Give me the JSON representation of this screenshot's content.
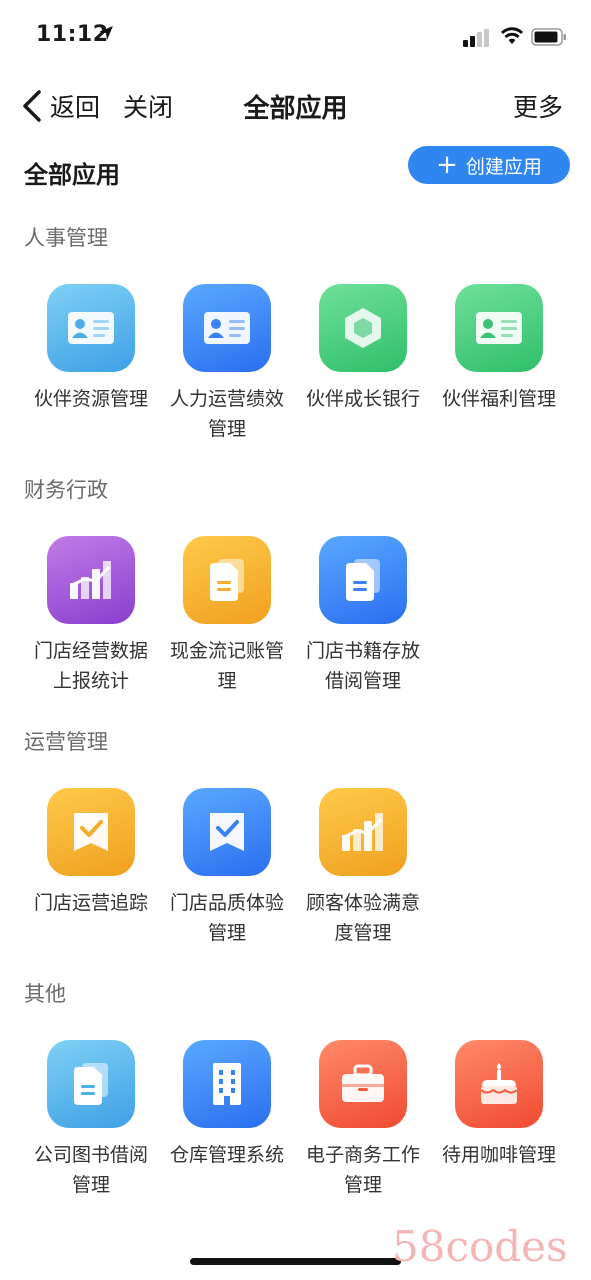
{
  "status_bar": {
    "time": "11:12"
  },
  "nav": {
    "back_label": "返回",
    "close_label": "关闭",
    "title": "全部应用",
    "more_label": "更多"
  },
  "header": {
    "section_title": "全部应用",
    "create_label": "创建应用"
  },
  "categories": [
    {
      "label": "人事管理",
      "apps": [
        {
          "name": "伙伴资源管理",
          "icon": "id-card-icon",
          "color": "lightblue"
        },
        {
          "name": "人力运营绩效管理",
          "icon": "id-card-icon",
          "color": "blue"
        },
        {
          "name": "伙伴成长银行",
          "icon": "cube-icon",
          "color": "green"
        },
        {
          "name": "伙伴福利管理",
          "icon": "id-card-icon",
          "color": "green"
        }
      ]
    },
    {
      "label": "财务行政",
      "apps": [
        {
          "name": "门店经营数据上报统计",
          "icon": "bar-chart-icon",
          "color": "purple"
        },
        {
          "name": "现金流记账管理",
          "icon": "document-icon",
          "color": "yellow"
        },
        {
          "name": "门店书籍存放借阅管理",
          "icon": "document-icon",
          "color": "blue"
        }
      ]
    },
    {
      "label": "运营管理",
      "apps": [
        {
          "name": "门店运营追踪",
          "icon": "checked-flag-icon",
          "color": "yellow"
        },
        {
          "name": "门店品质体验管理",
          "icon": "checked-flag-icon",
          "color": "blue"
        },
        {
          "name": "顾客体验满意度管理",
          "icon": "bar-chart-icon",
          "color": "yellow"
        }
      ]
    },
    {
      "label": "其他",
      "apps": [
        {
          "name": "公司图书借阅管理",
          "icon": "document-icon",
          "color": "lightblue"
        },
        {
          "name": "仓库管理系统",
          "icon": "building-icon",
          "color": "blue"
        },
        {
          "name": "电子商务工作管理",
          "icon": "briefcase-icon",
          "color": "red"
        },
        {
          "name": "待用咖啡管理",
          "icon": "cake-icon",
          "color": "red"
        }
      ]
    }
  ],
  "watermark": "58codes"
}
